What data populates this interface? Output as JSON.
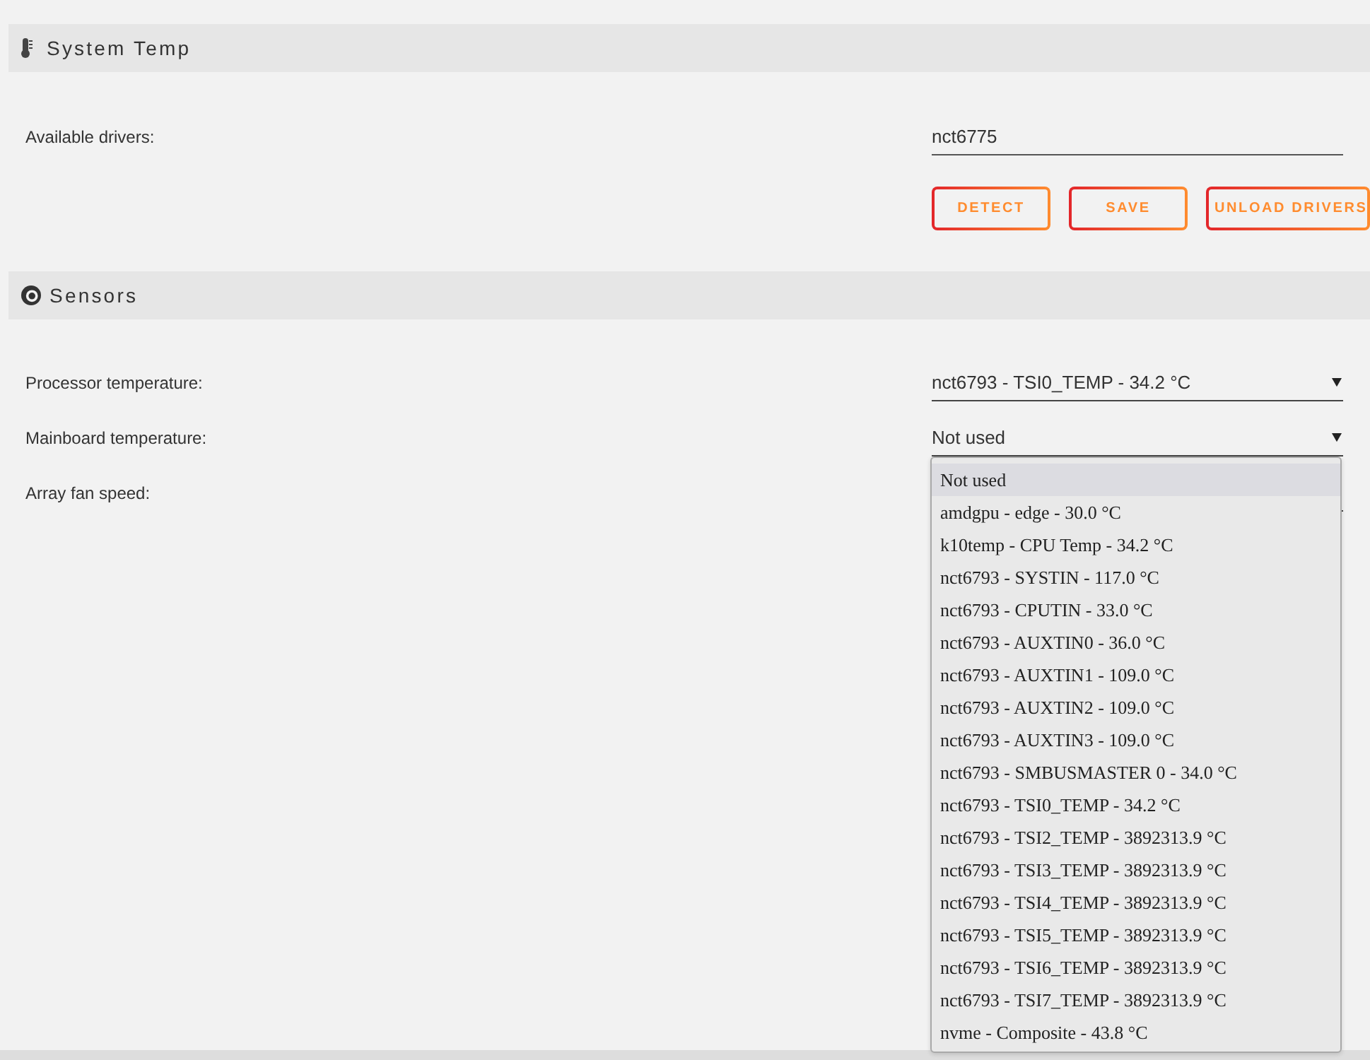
{
  "sections": [
    {
      "title": "System Temp",
      "fields": [
        {
          "kind": "text",
          "label": "Available drivers:",
          "value": "nct6775"
        }
      ],
      "buttons": [
        "DETECT",
        "SAVE",
        "UNLOAD DRIVERS"
      ]
    },
    {
      "title": "Sensors",
      "fields": [
        {
          "kind": "select",
          "label": "Processor temperature:",
          "value": "nct6793 - TSI0_TEMP - 34.2 °C",
          "expanded": false
        },
        {
          "kind": "select",
          "label": "Mainboard temperature:",
          "value": "Not used",
          "expanded": true,
          "options": [
            {
              "label": "Not used",
              "selected": true
            },
            {
              "label": "amdgpu - edge - 30.0 °C",
              "selected": false
            },
            {
              "label": "k10temp - CPU Temp - 34.2 °C",
              "selected": false
            },
            {
              "label": "nct6793 - SYSTIN - 117.0 °C",
              "selected": false
            },
            {
              "label": "nct6793 - CPUTIN - 33.0 °C",
              "selected": false
            },
            {
              "label": "nct6793 - AUXTIN0 - 36.0 °C",
              "selected": false
            },
            {
              "label": "nct6793 - AUXTIN1 - 109.0 °C",
              "selected": false
            },
            {
              "label": "nct6793 - AUXTIN2 - 109.0 °C",
              "selected": false
            },
            {
              "label": "nct6793 - AUXTIN3 - 109.0 °C",
              "selected": false
            },
            {
              "label": "nct6793 - SMBUSMASTER 0 - 34.0 °C",
              "selected": false
            },
            {
              "label": "nct6793 - TSI0_TEMP - 34.2 °C",
              "selected": false
            },
            {
              "label": "nct6793 - TSI2_TEMP - 3892313.9 °C",
              "selected": false
            },
            {
              "label": "nct6793 - TSI3_TEMP - 3892313.9 °C",
              "selected": false
            },
            {
              "label": "nct6793 - TSI4_TEMP - 3892313.9 °C",
              "selected": false
            },
            {
              "label": "nct6793 - TSI5_TEMP - 3892313.9 °C",
              "selected": false
            },
            {
              "label": "nct6793 - TSI6_TEMP - 3892313.9 °C",
              "selected": false
            },
            {
              "label": "nct6793 - TSI7_TEMP - 3892313.9 °C",
              "selected": false
            },
            {
              "label": "nvme - Composite - 43.8 °C",
              "selected": false
            }
          ]
        },
        {
          "kind": "select",
          "label": "Array fan speed:",
          "expanded": false
        }
      ]
    }
  ]
}
